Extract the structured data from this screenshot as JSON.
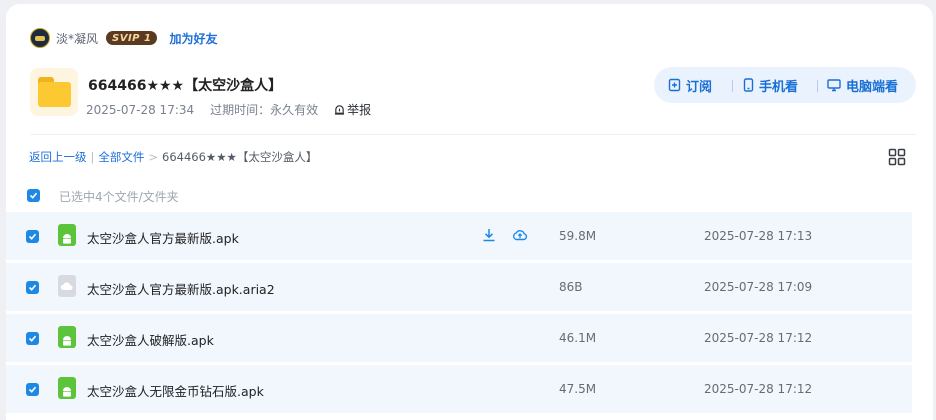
{
  "user": {
    "name": "淡*凝风",
    "badge": "SVIP 1",
    "add_friend": "加为好友"
  },
  "share": {
    "title": "664466★★★【太空沙盒人】",
    "date": "2025-07-28 17:34",
    "expiry": "过期时间：永久有效",
    "report": "举报"
  },
  "actions": {
    "subscribe": "订阅",
    "mobile": "手机看",
    "desktop": "电脑端看"
  },
  "breadcrumb": {
    "back": "返回上一级",
    "all_files": "全部文件",
    "current": "664466★★★【太空沙盒人】"
  },
  "selection": {
    "text": "已选中4个文件/文件夹"
  },
  "files": [
    {
      "name": "太空沙盒人官方最新版.apk",
      "size": "59.8M",
      "date": "2025-07-28 17:13",
      "icon": "apk-icon"
    },
    {
      "name": "太空沙盒人官方最新版.apk.aria2",
      "size": "86B",
      "date": "2025-07-28 17:09",
      "icon": "cloud-file-icon"
    },
    {
      "name": "太空沙盒人破解版.apk",
      "size": "46.1M",
      "date": "2025-07-28 17:12",
      "icon": "apk-icon"
    },
    {
      "name": "太空沙盒人无限金币钻石版.apk",
      "size": "47.5M",
      "date": "2025-07-28 17:12",
      "icon": "apk-icon"
    }
  ],
  "colors": {
    "accent": "#1e6fd9",
    "checkbox": "#1e88e5",
    "row_bg": "#f1f7fd",
    "folder": "#fcc933",
    "apk": "#5cc43a"
  }
}
